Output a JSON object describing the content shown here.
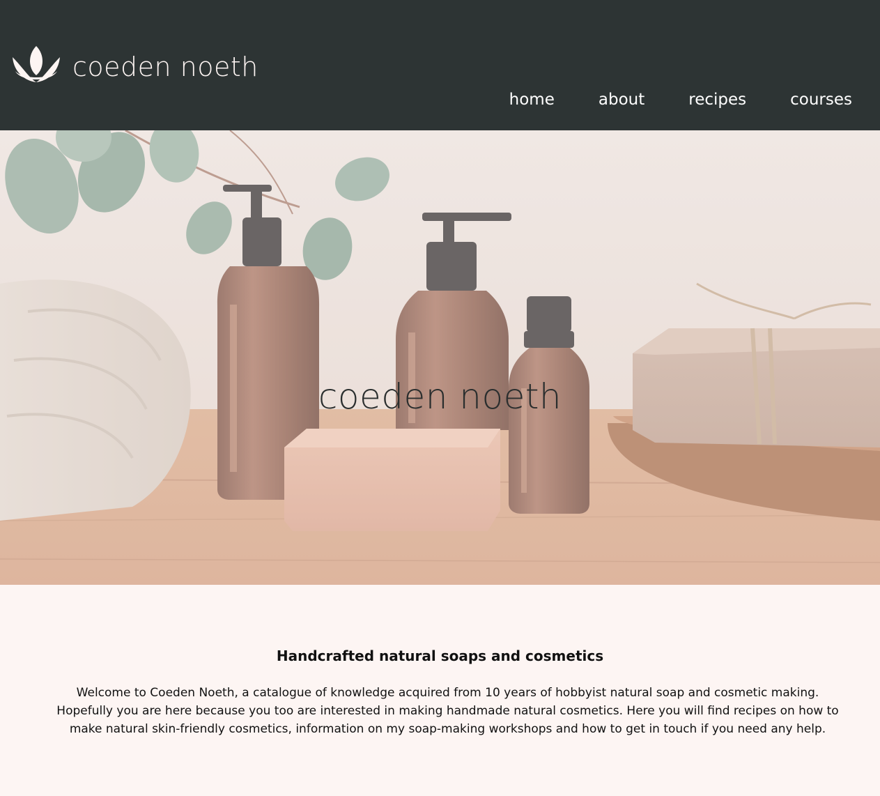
{
  "brand": {
    "name": "coeden noeth",
    "logo_icon": "lotus-icon",
    "logo_color": "#fdf5f3"
  },
  "nav": {
    "items": [
      {
        "label": "home"
      },
      {
        "label": "about"
      },
      {
        "label": "recipes"
      },
      {
        "label": "courses"
      }
    ]
  },
  "hero": {
    "title": "coeden noeth",
    "image_icon": "soap-and-bottles-photo"
  },
  "intro": {
    "heading": "Handcrafted natural soaps and cosmetics",
    "body": "Welcome to Coeden Noeth, a catalogue of knowledge acquired from 10 years of hobbyist natural soap and cosmetic making. Hopefully you are here because you too are interested in making handmade natural cosmetics. Here you will find recipes on how to make natural skin-friendly cosmetics, information on my soap-making workshops and how to get in touch if you need any help."
  },
  "colors": {
    "header_bg": "#2d3434",
    "page_bg": "#fdf5f3",
    "text": "#111111"
  }
}
